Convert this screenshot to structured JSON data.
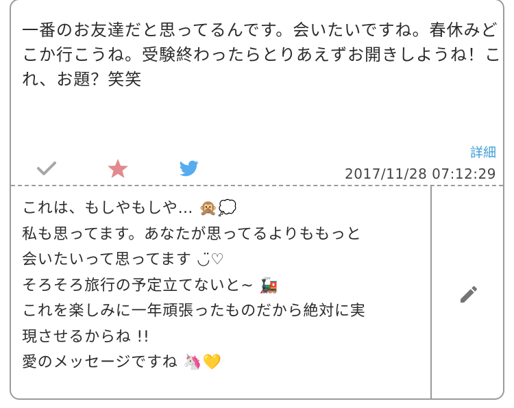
{
  "question": {
    "text": "一番のお友達だと思ってるんです。会いたいですね。春休みどこか行こうね。受験終わったらとりあえずお開きしようね！これ、お題？笑笑"
  },
  "actions": {
    "check_icon": "check-icon",
    "star_icon": "star-icon",
    "twitter_icon": "twitter-icon",
    "details_label": "詳細",
    "timestamp": "2017/11/28 07:12:29"
  },
  "answer": {
    "lines": [
      "これは、もしやもしや… 🙊💭",
      "私も思ってます。あなたが思ってるよりももっと",
      "会いたいって思ってます ◡̈♡",
      "そろそろ旅行の予定立てないと~ 🚂",
      "これを楽しみに一年頑張ったものだから絶対に実",
      "現させるからね !!",
      "愛のメッセージですね 🦄💛"
    ]
  },
  "edit": {
    "icon": "pencil-icon"
  },
  "colors": {
    "border": "#9a9a9a",
    "check": "#a6a6a6",
    "star": "#e28a8f",
    "twitter": "#55acee",
    "link": "#3f9fd6",
    "pencil": "#757575"
  }
}
